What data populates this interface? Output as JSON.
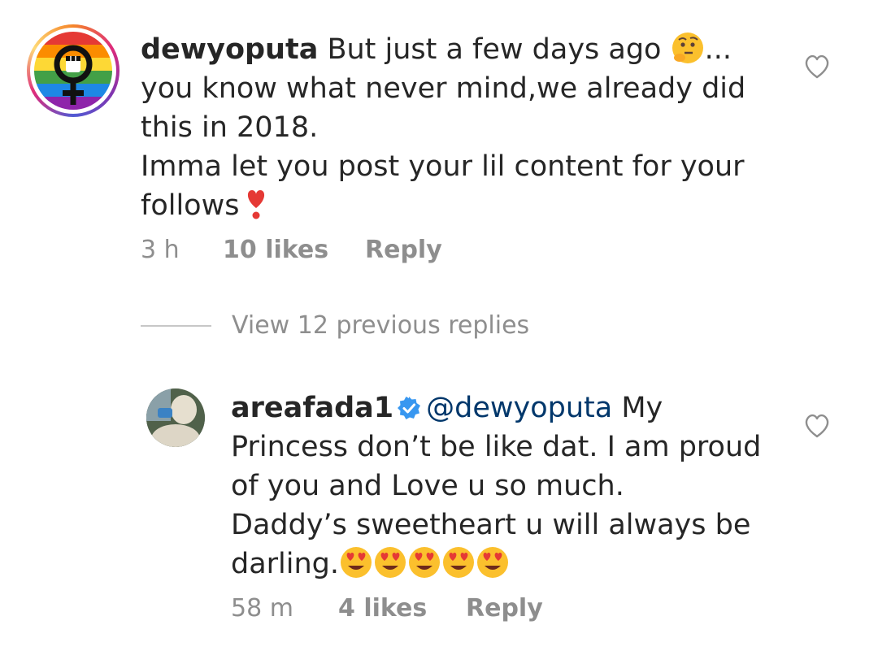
{
  "comments": [
    {
      "username": "dewyoputa",
      "text_line1": " But just a few days ago ",
      "text_after_emoji": "...",
      "text_rest": "you know what never mind,we already did\nthis in 2018.\nImma let you post your lil content for your\nfollows",
      "emoji_thinking": "thinking-face-icon",
      "emoji_heart": "heavy-heart-exclamation-icon",
      "time": "3 h",
      "likes": "10 likes",
      "reply_label": "Reply"
    },
    {
      "username": "areafada1",
      "verified": true,
      "mention": "@dewyoputa",
      "text_line1": " My",
      "text_rest": "Princess don’t be like dat. I am proud\nof you and Love u so much.\nDaddy’s sweetheart u will always be\ndarling.",
      "emoji_hearteyes": "heart-eyes-icon",
      "emoji_count": 5,
      "time": "58 m",
      "likes": "4 likes",
      "reply_label": "Reply"
    }
  ],
  "view_previous": "View 12 previous replies",
  "colors": {
    "text": "#262626",
    "meta": "#8e8e8e",
    "mention": "#00376b",
    "verified": "#3897f0"
  }
}
